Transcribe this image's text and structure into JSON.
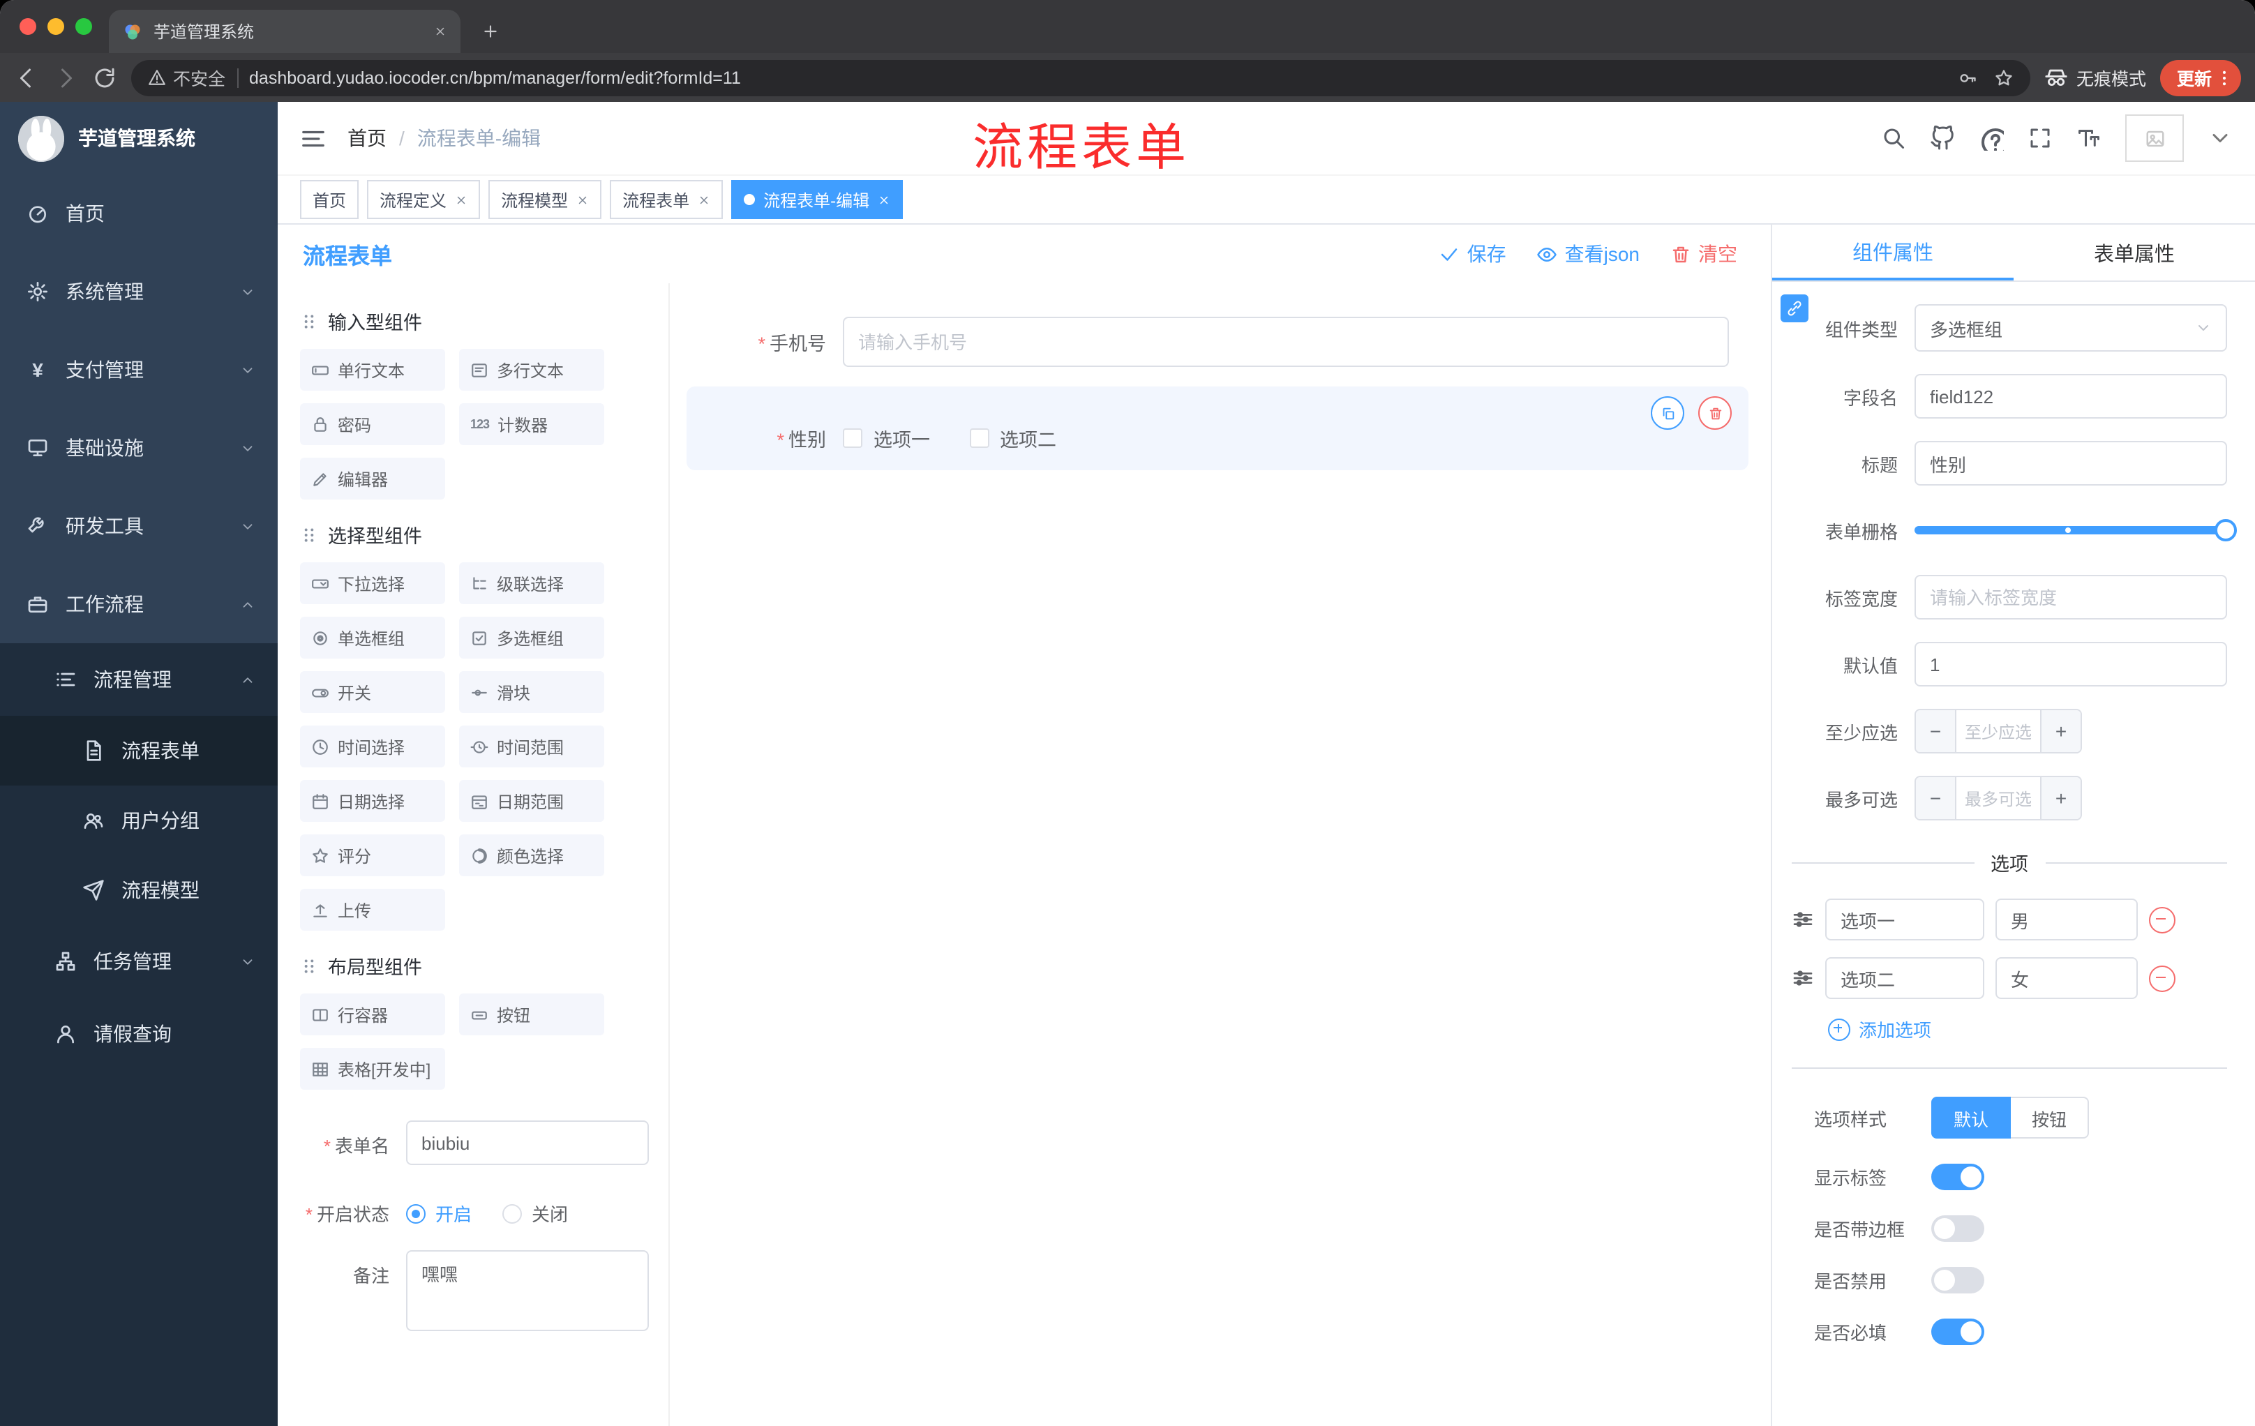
{
  "required_mark": "*",
  "browser": {
    "tab_title": "芋道管理系统",
    "security_label": "不安全",
    "url": "dashboard.yudao.iocoder.cn/bpm/manager/form/edit?formId=11",
    "incognito_label": "无痕模式",
    "update_label": "更新"
  },
  "sidebar": {
    "logo_title": "芋道管理系统",
    "items": [
      {
        "label": "首页"
      },
      {
        "label": "系统管理"
      },
      {
        "label": "支付管理"
      },
      {
        "label": "基础设施"
      },
      {
        "label": "研发工具"
      },
      {
        "label": "工作流程"
      },
      {
        "label": "流程管理"
      },
      {
        "label": "流程表单"
      },
      {
        "label": "用户分组"
      },
      {
        "label": "流程模型"
      },
      {
        "label": "任务管理"
      },
      {
        "label": "请假查询"
      }
    ]
  },
  "header": {
    "breadcrumb": {
      "home": "首页",
      "separator": "/",
      "current": "流程表单-编辑"
    },
    "annotation": "流程表单"
  },
  "tags": [
    {
      "label": "首页"
    },
    {
      "label": "流程定义"
    },
    {
      "label": "流程模型"
    },
    {
      "label": "流程表单"
    },
    {
      "label": "流程表单-编辑"
    }
  ],
  "designer": {
    "title": "流程表单",
    "actions": {
      "save": "保存",
      "view_json": "查看json",
      "clear": "清空"
    },
    "palette": {
      "sections": [
        {
          "title": "输入型组件",
          "items": [
            {
              "label": "单行文本"
            },
            {
              "label": "多行文本"
            },
            {
              "label": "密码"
            },
            {
              "label": "计数器"
            },
            {
              "label": "编辑器"
            }
          ]
        },
        {
          "title": "选择型组件",
          "items": [
            {
              "label": "下拉选择"
            },
            {
              "label": "级联选择"
            },
            {
              "label": "单选框组"
            },
            {
              "label": "多选框组"
            },
            {
              "label": "开关"
            },
            {
              "label": "滑块"
            },
            {
              "label": "时间选择"
            },
            {
              "label": "时间范围"
            },
            {
              "label": "日期选择"
            },
            {
              "label": "日期范围"
            },
            {
              "label": "评分"
            },
            {
              "label": "颜色选择"
            },
            {
              "label": "上传"
            }
          ]
        },
        {
          "title": "布局型组件",
          "items": [
            {
              "label": "行容器"
            },
            {
              "label": "按钮"
            },
            {
              "label": "表格[开发中]"
            }
          ]
        }
      ]
    },
    "form_meta": {
      "name_label": "表单名",
      "name_value": "biubiu",
      "status_label": "开启状态",
      "status_on": "开启",
      "status_off": "关闭",
      "remark_label": "备注",
      "remark_value": "嘿嘿"
    },
    "canvas": {
      "phone": {
        "label": "手机号",
        "placeholder": "请输入手机号"
      },
      "gender": {
        "label": "性别",
        "options": [
          "选项一",
          "选项二"
        ]
      }
    }
  },
  "properties": {
    "tabs": {
      "component": "组件属性",
      "form": "表单属性"
    },
    "fields": {
      "type_label": "组件类型",
      "type_value": "多选框组",
      "field_label": "字段名",
      "field_value": "field122",
      "title_label": "标题",
      "title_value": "性别",
      "grid_label": "表单栅格",
      "width_label": "标签宽度",
      "width_placeholder": "请输入标签宽度",
      "default_label": "默认值",
      "default_value": "1",
      "min_label": "至少应选",
      "min_placeholder": "至少应选",
      "max_label": "最多可选",
      "max_placeholder": "最多可选"
    },
    "options": {
      "divider": "选项",
      "rows": [
        {
          "name": "选项一",
          "value": "男"
        },
        {
          "name": "选项二",
          "value": "女"
        }
      ],
      "add": "添加选项"
    },
    "style": {
      "label": "选项样式",
      "default": "默认",
      "button": "按钮"
    },
    "switches": [
      {
        "label": "显示标签",
        "on": true
      },
      {
        "label": "是否带边框",
        "on": false
      },
      {
        "label": "是否禁用",
        "on": false
      },
      {
        "label": "是否必填",
        "on": true
      }
    ]
  },
  "colors": {
    "primary": "#409EFF",
    "danger": "#F56C6C",
    "sidebar_bg": "#304156",
    "submenu_bg": "#1F2D3D",
    "tag_active": "#409EFF",
    "annotation": "#FA2C2C",
    "update_button": "#E2503C"
  }
}
